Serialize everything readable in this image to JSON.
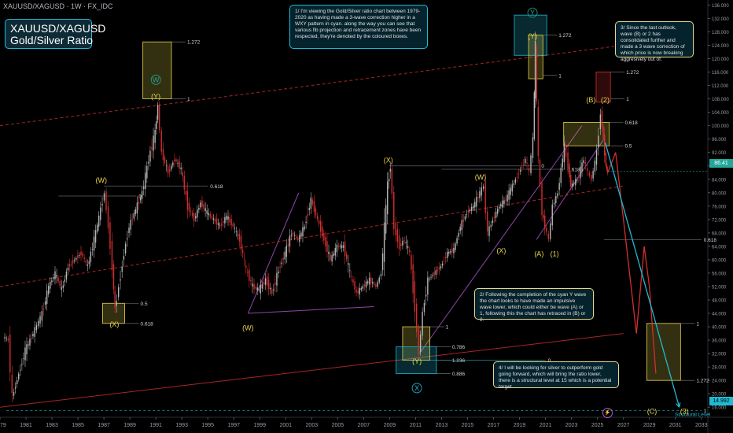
{
  "header": {
    "title": "XAUUSD/XAGUSD · 1W · FX_IDC"
  },
  "title_box": {
    "line1": "XAUUSD/XAGUSD",
    "line2": "Gold/Silver Ratio"
  },
  "notes": {
    "n1": "1/ I'm viewing the Gold/Silver ratio chart between 1979-2020 as having made a 3-wave correction higher in a WXY pattern in cyan. along the way you can see that various fib projection and retracement zones have been respected, they're denoted by the coloured boxes.",
    "n2": "2/ Following the completion of the cyan Y wave the chart looks to have made an impulsive wave lower, which could either be wave (A) or 1, following this the chart has retraced in (B) or 2.",
    "n3": "3/ Since the last outlook, wave (B) or 2 has consolidated further and made a 3 wave correction of which price is now breaking aggresively out of.",
    "n4": "4/ I will be looking for silver to outperform gold going forward, which will bring the ratio lower, there is a structural level at 15 which is a potential target."
  },
  "current_price": {
    "label": "86.41",
    "sub": "09:44",
    "color": "#26a69a"
  },
  "structural": {
    "label": "Structural Level",
    "price_label": "14.992"
  },
  "footer_icon": "lightning-icon",
  "chart_data": {
    "type": "line",
    "title": "Gold/Silver Ratio",
    "xlabel": "",
    "ylabel": "",
    "x_ticks": [
      "1979",
      "1981",
      "1983",
      "1985",
      "1987",
      "1989",
      "1991",
      "1993",
      "1995",
      "1997",
      "1999",
      "2001",
      "2003",
      "2005",
      "2007",
      "2009",
      "2011",
      "2013",
      "2015",
      "2017",
      "2019",
      "2021",
      "2023",
      "2025",
      "2027",
      "2029",
      "2031",
      "2033"
    ],
    "xlim": [
      1979,
      2033.5
    ],
    "ylim": [
      12,
      136
    ],
    "y_ticks": [
      16,
      20,
      24,
      28,
      32,
      36,
      40,
      44,
      48,
      52,
      56,
      60,
      64,
      68,
      72,
      76,
      80,
      84,
      88,
      92,
      96,
      100,
      104,
      108,
      112,
      116,
      120,
      124,
      128,
      132,
      136
    ],
    "y_tick_labels": [
      "16.000",
      "20.000",
      "24.000",
      "28.000",
      "32.000",
      "36.000",
      "40.000",
      "44.000",
      "48.000",
      "52.000",
      "56.000",
      "60.000",
      "64.000",
      "68.000",
      "72.000",
      "76.000",
      "80.000",
      "84.000",
      "88.000",
      "92.000",
      "96.000",
      "100.000",
      "104.000",
      "108.000",
      "112.000",
      "116.000",
      "120.000",
      "124.000",
      "128.000",
      "132.000",
      "136.000"
    ],
    "series": [
      {
        "style": "candles-approx",
        "color_up": "#b7b7b7",
        "color_down": "#d32f2f",
        "points": [
          [
            1979.3,
            37
          ],
          [
            1979.7,
            36
          ],
          [
            1980.0,
            19
          ],
          [
            1980.5,
            26
          ],
          [
            1981.0,
            33
          ],
          [
            1981.6,
            38
          ],
          [
            1982.3,
            44
          ],
          [
            1982.8,
            52
          ],
          [
            1983.3,
            56
          ],
          [
            1983.8,
            51
          ],
          [
            1984.3,
            58
          ],
          [
            1984.8,
            60
          ],
          [
            1985.3,
            62
          ],
          [
            1985.8,
            58
          ],
          [
            1986.3,
            66
          ],
          [
            1986.8,
            75
          ],
          [
            1987.1,
            80
          ],
          [
            1987.4,
            70
          ],
          [
            1987.7,
            58
          ],
          [
            1987.9,
            45
          ],
          [
            1988.2,
            52
          ],
          [
            1988.6,
            62
          ],
          [
            1989.0,
            70
          ],
          [
            1989.5,
            75
          ],
          [
            1990.0,
            80
          ],
          [
            1990.5,
            90
          ],
          [
            1991.0,
            98
          ],
          [
            1991.2,
            106
          ],
          [
            1991.5,
            92
          ],
          [
            1992.0,
            86
          ],
          [
            1992.5,
            90
          ],
          [
            1993.0,
            87
          ],
          [
            1993.5,
            76
          ],
          [
            1994.0,
            72
          ],
          [
            1994.5,
            77
          ],
          [
            1995.0,
            74
          ],
          [
            1995.5,
            72
          ],
          [
            1996.0,
            70
          ],
          [
            1996.5,
            73
          ],
          [
            1997.0,
            70
          ],
          [
            1997.5,
            66
          ],
          [
            1998.0,
            57
          ],
          [
            1998.5,
            52
          ],
          [
            1999.0,
            51
          ],
          [
            1999.5,
            54
          ],
          [
            2000.0,
            50
          ],
          [
            2000.5,
            57
          ],
          [
            2001.0,
            62
          ],
          [
            2001.5,
            68
          ],
          [
            2002.0,
            66
          ],
          [
            2002.5,
            70
          ],
          [
            2003.0,
            78
          ],
          [
            2003.5,
            72
          ],
          [
            2004.0,
            66
          ],
          [
            2004.5,
            60
          ],
          [
            2005.0,
            64
          ],
          [
            2005.5,
            64
          ],
          [
            2006.0,
            56
          ],
          [
            2006.5,
            50
          ],
          [
            2007.0,
            52
          ],
          [
            2007.5,
            54
          ],
          [
            2008.0,
            52
          ],
          [
            2008.4,
            56
          ],
          [
            2008.9,
            82
          ],
          [
            2009.1,
            88
          ],
          [
            2009.4,
            70
          ],
          [
            2009.8,
            64
          ],
          [
            2010.2,
            66
          ],
          [
            2010.6,
            62
          ],
          [
            2011.0,
            46
          ],
          [
            2011.3,
            32
          ],
          [
            2011.6,
            44
          ],
          [
            2012.0,
            54
          ],
          [
            2012.5,
            56
          ],
          [
            2013.0,
            58
          ],
          [
            2013.5,
            62
          ],
          [
            2014.0,
            63
          ],
          [
            2014.5,
            70
          ],
          [
            2015.0,
            74
          ],
          [
            2015.5,
            76
          ],
          [
            2016.0,
            80
          ],
          [
            2016.3,
            82
          ],
          [
            2016.6,
            68
          ],
          [
            2017.0,
            72
          ],
          [
            2017.5,
            76
          ],
          [
            2018.0,
            78
          ],
          [
            2018.5,
            82
          ],
          [
            2019.0,
            86
          ],
          [
            2019.5,
            90
          ],
          [
            2019.8,
            86
          ],
          [
            2020.1,
            96
          ],
          [
            2020.25,
            124
          ],
          [
            2020.5,
            90
          ],
          [
            2020.8,
            74
          ],
          [
            2021.0,
            70
          ],
          [
            2021.3,
            66
          ],
          [
            2021.6,
            76
          ],
          [
            2022.0,
            80
          ],
          [
            2022.5,
            94
          ],
          [
            2022.8,
            88
          ],
          [
            2023.0,
            82
          ],
          [
            2023.5,
            84
          ],
          [
            2024.0,
            90
          ],
          [
            2024.3,
            86
          ],
          [
            2024.6,
            84
          ],
          [
            2025.0,
            92
          ],
          [
            2025.3,
            104
          ],
          [
            2025.5,
            96
          ],
          [
            2025.7,
            88
          ],
          [
            2025.8,
            86
          ]
        ]
      },
      {
        "name": "",
        "style": "projection",
        "color": "#d32f2f",
        "points": [
          [
            2025.8,
            86
          ],
          [
            2026.4,
            92
          ],
          [
            2027.0,
            72
          ],
          [
            2028.0,
            38
          ],
          [
            2028.6,
            64
          ],
          [
            2029.0,
            52
          ],
          [
            2029.5,
            26
          ]
        ]
      },
      {
        "name": "",
        "style": "projection",
        "color": "#1fbad6",
        "points": [
          [
            2025.6,
            95
          ],
          [
            2031.3,
            16
          ]
        ]
      }
    ],
    "wave_labels": [
      {
        "text": "(W)",
        "x": 1986.8,
        "y": 83,
        "color": "#e8d44d"
      },
      {
        "text": "(X)",
        "x": 1987.8,
        "y": 40,
        "color": "#e8d44d"
      },
      {
        "text": "W",
        "x": 1991.0,
        "y": 113,
        "color": "#26a69a",
        "circled": true
      },
      {
        "text": "(Y)",
        "x": 1991.0,
        "y": 108,
        "color": "#e8d44d"
      },
      {
        "text": "(W)",
        "x": 1998.1,
        "y": 39,
        "color": "#e8d44d"
      },
      {
        "text": "(X)",
        "x": 2008.9,
        "y": 89,
        "color": "#e8d44d"
      },
      {
        "text": "(Y)",
        "x": 2011.1,
        "y": 29,
        "color": "#e8d44d"
      },
      {
        "text": "X",
        "x": 2011.1,
        "y": 21,
        "color": "#1fbad6",
        "circled": true
      },
      {
        "text": "(W)",
        "x": 2016.0,
        "y": 84,
        "color": "#e8d44d"
      },
      {
        "text": "(X)",
        "x": 2017.6,
        "y": 62,
        "color": "#e8d44d"
      },
      {
        "text": "Y",
        "x": 2020.0,
        "y": 133,
        "color": "#26a69a",
        "circled": true
      },
      {
        "text": "(Y)",
        "x": 2020.0,
        "y": 126,
        "color": "#e8d44d"
      },
      {
        "text": "(A)",
        "x": 2020.5,
        "y": 61,
        "color": "#e8d44d"
      },
      {
        "text": "(1)",
        "x": 2021.7,
        "y": 61,
        "color": "#e8d44d"
      },
      {
        "text": "(B)",
        "x": 2024.5,
        "y": 107,
        "color": "#e8d44d"
      },
      {
        "text": "(2)",
        "x": 2025.6,
        "y": 107,
        "color": "#e8d44d"
      },
      {
        "text": "(C)",
        "x": 2029.2,
        "y": 14,
        "color": "#e8d44d"
      },
      {
        "text": "(3)",
        "x": 2031.7,
        "y": 14,
        "color": "#e8d44d"
      }
    ],
    "fib_boxes": [
      {
        "x0": 1990.0,
        "x1": 1992.2,
        "y0": 108,
        "y1": 125,
        "color": "#e8d44d",
        "labels": [
          {
            "text": "1.272",
            "y": 125
          },
          {
            "text": "1",
            "y": 108
          }
        ]
      },
      {
        "x0": 1986.9,
        "x1": 1988.6,
        "y0": 41,
        "y1": 47,
        "color": "#e8d44d",
        "labels": [
          {
            "text": "0.5",
            "y": 47
          },
          {
            "text": "0.618",
            "y": 41
          }
        ]
      },
      {
        "x0": 2018.6,
        "x1": 2021.1,
        "y0": 121,
        "y1": 133,
        "color": "#1fbad6",
        "labels": []
      },
      {
        "x0": 2019.7,
        "x1": 2020.8,
        "y0": 114,
        "y1": 127,
        "color": "#e8d44d",
        "labels": [
          {
            "text": "1.272",
            "y": 127
          },
          {
            "text": "1",
            "y": 115
          }
        ]
      },
      {
        "x0": 2010.0,
        "x1": 2012.1,
        "y0": 30,
        "y1": 40,
        "color": "#e8d44d",
        "labels": [
          {
            "text": "1",
            "y": 40
          }
        ]
      },
      {
        "x0": 2009.5,
        "x1": 2012.6,
        "y0": 26,
        "y1": 34,
        "color": "#1fbad6",
        "labels": [
          {
            "text": "0.786",
            "y": 34
          },
          {
            "text": "0.886",
            "y": 26
          },
          {
            "text": "1.236",
            "y": 30
          }
        ]
      },
      {
        "x0": 2022.4,
        "x1": 2025.9,
        "y0": 94,
        "y1": 101,
        "color": "#e8d44d",
        "labels": [
          {
            "text": "0.618",
            "y": 101
          },
          {
            "text": "0.5",
            "y": 94
          }
        ]
      },
      {
        "x0": 2024.9,
        "x1": 2026.0,
        "y0": 107,
        "y1": 116,
        "color": "#d32f2f",
        "labels": [
          {
            "text": "1.272",
            "y": 116
          },
          {
            "text": "1",
            "y": 108
          }
        ]
      },
      {
        "x0": 2028.8,
        "x1": 2031.4,
        "y0": 24,
        "y1": 41,
        "color": "#e8d44d",
        "labels": [
          {
            "text": "1",
            "y": 41
          },
          {
            "text": "1.272",
            "y": 24
          }
        ]
      }
    ],
    "fib_lines": [
      {
        "y": 79,
        "x0": 1983.5,
        "x1": 1989.5,
        "label": "0",
        "color": "#787b86"
      },
      {
        "y": 82,
        "x0": 1987.0,
        "x1": 1995.0,
        "label": "0.618",
        "color": "#787b86"
      },
      {
        "y": 88,
        "x0": 2009.0,
        "x1": 2020.5,
        "label": "0",
        "color": "#787b86"
      },
      {
        "y": 87,
        "x0": 2013.0,
        "x1": 2022.5,
        "label": "0.618",
        "color": "#787b86"
      },
      {
        "y": 30,
        "x0": 2010.0,
        "x1": 2021.0,
        "label": "0",
        "color": "#1fbad6"
      },
      {
        "y": 66,
        "x0": 2025.5,
        "x1": 2033.0,
        "label": "0.618",
        "color": "#787b86"
      },
      {
        "y": 15,
        "x0": 1979.5,
        "x1": 2033.0,
        "label": "1",
        "color": "#1fbad6",
        "dashed": true
      }
    ],
    "trend_lines": [
      {
        "points": [
          [
            1979.0,
            100
          ],
          [
            2027.0,
            124
          ]
        ],
        "color": "#d32f2f",
        "dashed": true
      },
      {
        "points": [
          [
            1979.0,
            52
          ],
          [
            2027.0,
            82
          ]
        ],
        "color": "#d32f2f",
        "dashed": true
      },
      {
        "points": [
          [
            1979.0,
            16
          ],
          [
            2027.0,
            38
          ]
        ],
        "color": "#d32f2f",
        "dashed": false
      },
      {
        "points": [
          [
            2011.3,
            32
          ],
          [
            2023.8,
            100
          ]
        ],
        "color": "#b05ad6",
        "dashed": false
      },
      {
        "points": [
          [
            2020.3,
            66
          ],
          [
            2025.5,
            96
          ]
        ],
        "color": "#b05ad6",
        "dashed": false
      },
      {
        "points": [
          [
            1998.1,
            44
          ],
          [
            2002.0,
            80
          ]
        ],
        "color": "#b05ad6",
        "dashed": false
      },
      {
        "points": [
          [
            1998.1,
            44
          ],
          [
            2007.8,
            46
          ]
        ],
        "color": "#b05ad6",
        "dashed": false
      }
    ]
  }
}
